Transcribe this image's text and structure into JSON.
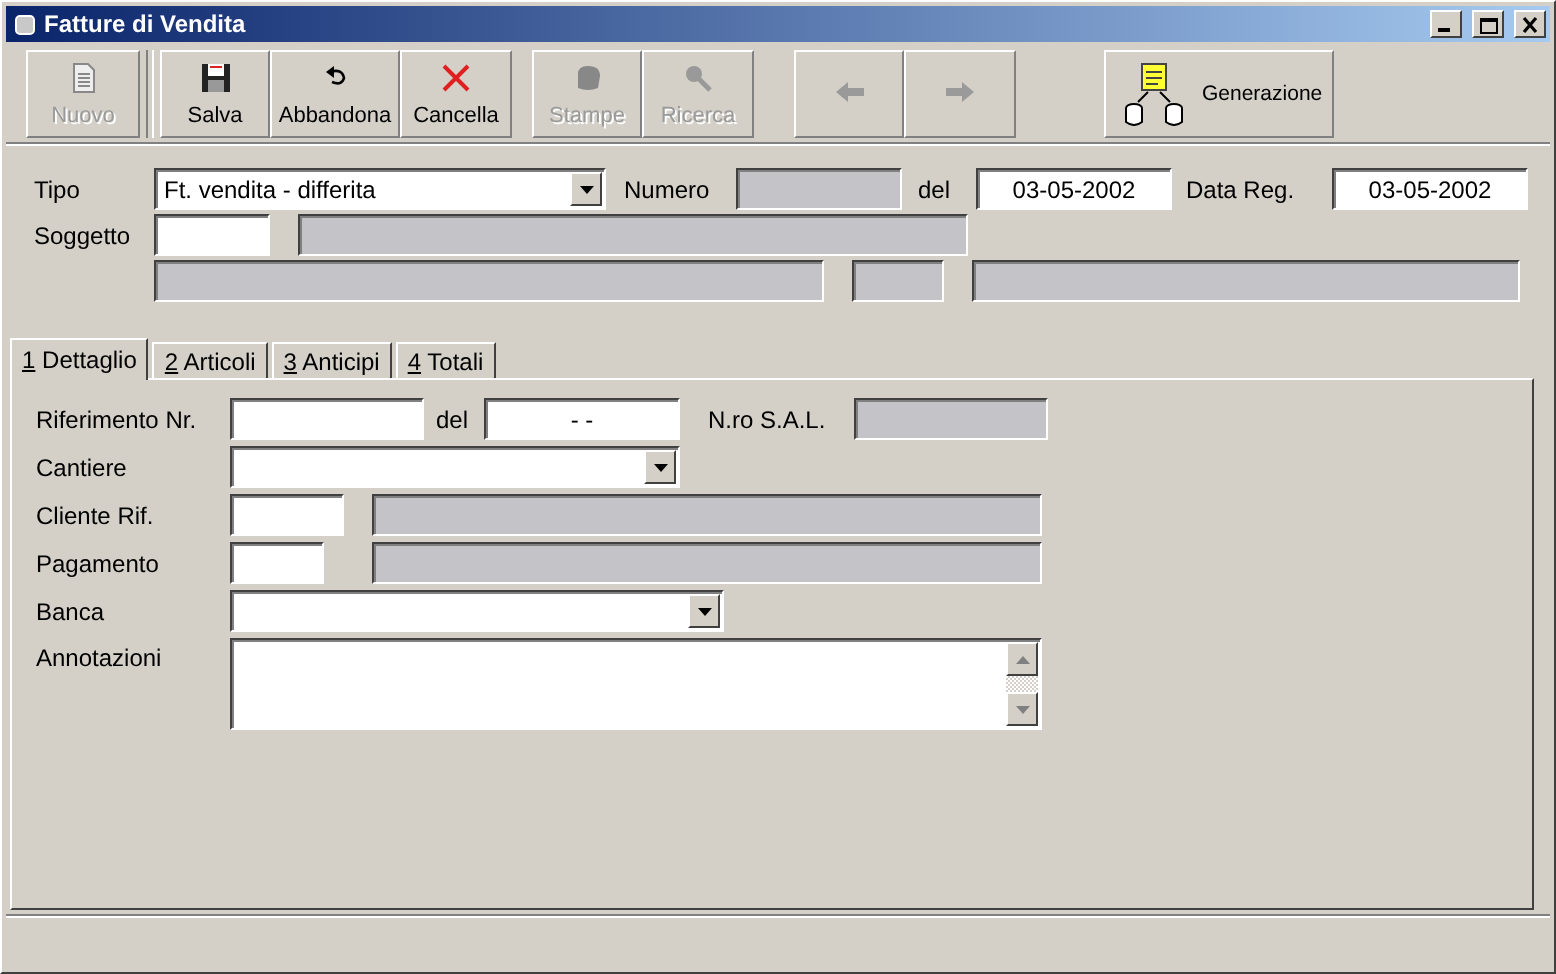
{
  "window": {
    "title": "Fatture di Vendita"
  },
  "toolbar": {
    "groups": [
      [
        {
          "kind": "button",
          "label": "Nuovo",
          "disabled": true
        }
      ],
      [
        {
          "kind": "button",
          "label": "Salva",
          "disabled": false
        },
        {
          "kind": "button",
          "label": "Abbandona",
          "disabled": false
        },
        {
          "kind": "button",
          "label": "Cancella",
          "disabled": false
        }
      ],
      [
        {
          "kind": "button",
          "label": "Stampe",
          "disabled": true
        },
        {
          "kind": "button",
          "label": "Ricerca",
          "disabled": true
        }
      ],
      [
        {
          "kind": "nav",
          "disabled": true
        },
        {
          "kind": "nav",
          "disabled": true
        }
      ],
      [
        {
          "kind": "wide",
          "label": "Generazione",
          "disabled": false
        }
      ]
    ]
  },
  "header": {
    "rows": [
      [
        {
          "kind": "label",
          "text": "Tipo"
        },
        {
          "kind": "select",
          "value": "Ft. vendita - differita"
        },
        {
          "kind": "label",
          "text": "Numero"
        },
        {
          "kind": "field",
          "readonly": true
        },
        {
          "kind": "label",
          "text": "del"
        },
        {
          "kind": "field",
          "readonly": false,
          "value": "03-05-2002"
        },
        {
          "kind": "label",
          "text": "Data Reg."
        },
        {
          "kind": "field",
          "readonly": false,
          "value": "03-05-2002"
        }
      ],
      [
        {
          "kind": "label",
          "text": "Soggetto"
        },
        {
          "kind": "field",
          "readonly": false
        },
        {
          "kind": "field",
          "readonly": true
        }
      ],
      [
        {
          "kind": "field",
          "readonly": true
        },
        {
          "kind": "field",
          "readonly": true
        },
        {
          "kind": "field",
          "readonly": true
        }
      ]
    ]
  },
  "tabs": [
    {
      "key": "1",
      "label": "Dettaglio",
      "selected": true
    },
    {
      "key": "2",
      "label": "Articoli",
      "selected": false
    },
    {
      "key": "3",
      "label": "Anticipi",
      "selected": false
    },
    {
      "key": "4",
      "label": "Totali",
      "selected": false
    }
  ],
  "detail": {
    "rows": [
      [
        {
          "kind": "label",
          "text": "Riferimento Nr."
        },
        {
          "kind": "field",
          "readonly": false
        },
        {
          "kind": "label",
          "text": "del"
        },
        {
          "kind": "field",
          "readonly": false,
          "value": "- -"
        },
        {
          "kind": "label",
          "text": "N.ro S.A.L."
        },
        {
          "kind": "field",
          "readonly": true
        }
      ],
      [
        {
          "kind": "label",
          "text": "Cantiere"
        },
        {
          "kind": "select"
        }
      ],
      [
        {
          "kind": "label",
          "text": "Cliente Rif."
        },
        {
          "kind": "field",
          "readonly": false
        },
        {
          "kind": "field",
          "readonly": true
        }
      ],
      [
        {
          "kind": "label",
          "text": "Pagamento"
        },
        {
          "kind": "field",
          "readonly": false
        },
        {
          "kind": "field",
          "readonly": true
        }
      ],
      [
        {
          "kind": "label",
          "text": "Banca"
        },
        {
          "kind": "select"
        }
      ],
      [
        {
          "kind": "label",
          "text": "Annotazioni"
        },
        {
          "kind": "textarea"
        }
      ]
    ]
  }
}
